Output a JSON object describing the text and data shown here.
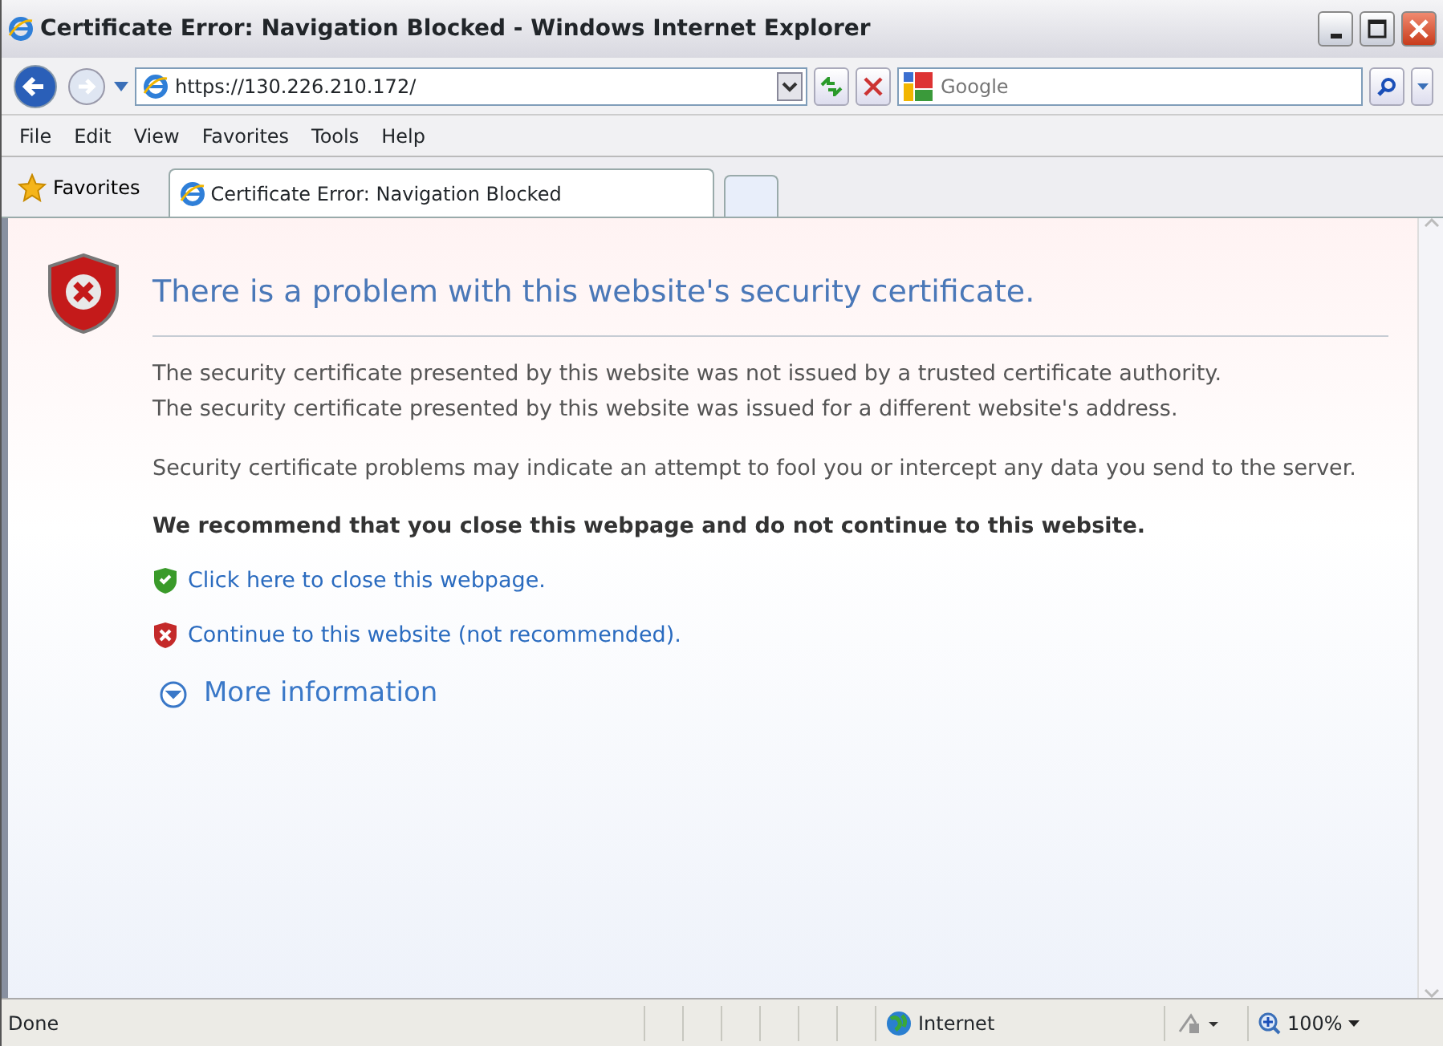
{
  "window": {
    "title": "Certificate Error: Navigation Blocked - Windows Internet Explorer"
  },
  "address": {
    "url": "https://130.226.210.172/"
  },
  "search": {
    "placeholder": "Google"
  },
  "menu": [
    "File",
    "Edit",
    "View",
    "Favorites",
    "Tools",
    "Help"
  ],
  "favorites_button": "Favorites",
  "tabs": [
    {
      "label": "Certificate Error: Navigation Blocked",
      "selected": true
    }
  ],
  "content": {
    "heading": "There is a problem with this website's security certificate.",
    "paragraphs": [
      [
        "The security certificate presented by this website was not issued by a trusted certificate authority.",
        "The security certificate presented by this website was issued for a different website's address."
      ],
      [
        "Security certificate problems may indicate an attempt to fool you or intercept any data you send to the server."
      ]
    ],
    "recommendation": "We recommend that you close this webpage and do not continue to this website.",
    "links": [
      {
        "kind": "safe",
        "text": "Click here to close this webpage."
      },
      {
        "kind": "unsafe",
        "text": "Continue to this website (not recommended)."
      }
    ],
    "more_info": {
      "text": "More information",
      "expanded": false
    }
  },
  "status_bar": {
    "text": "Done",
    "zone": "Internet",
    "zoom": "100%"
  }
}
